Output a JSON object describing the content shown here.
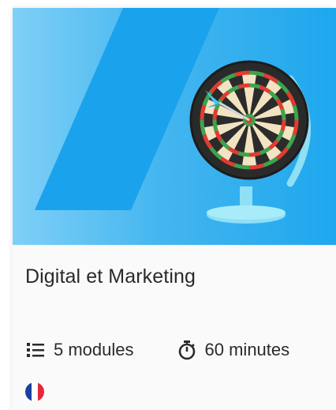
{
  "course": {
    "title": "Digital et Marketing",
    "modules": "5 modules",
    "duration": "60 minutes"
  },
  "hero": {
    "illustration": "dartboard-globe",
    "background_color": "#3eb2ee",
    "stripe_color": "#1aa4ec"
  },
  "icons": {
    "modules": "list-icon",
    "duration": "stopwatch-icon",
    "language": "france-flag-icon"
  },
  "colors": {
    "text": "#2a2a2a",
    "flag_blue": "#1a3fa0",
    "flag_white": "#ffffff",
    "flag_red": "#e4283a"
  }
}
